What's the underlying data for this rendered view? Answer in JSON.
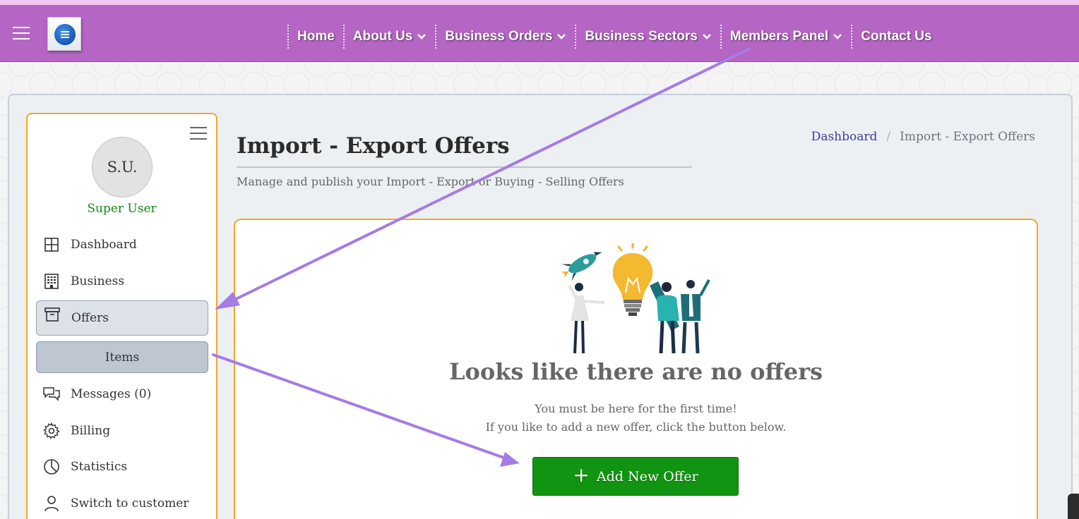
{
  "nav": {
    "items": [
      {
        "label": "Home",
        "dropdown": false
      },
      {
        "label": "About Us",
        "dropdown": true
      },
      {
        "label": "Business Orders",
        "dropdown": true
      },
      {
        "label": "Business Sectors",
        "dropdown": true
      },
      {
        "label": "Members Panel",
        "dropdown": true
      },
      {
        "label": "Contact Us",
        "dropdown": false
      }
    ]
  },
  "sidebar": {
    "avatar_initials": "S.U.",
    "username": "Super User",
    "items": [
      {
        "label": "Dashboard",
        "icon": "grid-icon"
      },
      {
        "label": "Business",
        "icon": "building-icon"
      },
      {
        "label": "Offers",
        "icon": "archive-box-icon",
        "active": true
      },
      {
        "label": "Items",
        "icon": "",
        "sub": true
      },
      {
        "label": "Messages (0)",
        "icon": "chat-icon"
      },
      {
        "label": "Billing",
        "icon": "gear-icon"
      },
      {
        "label": "Statistics",
        "icon": "pie-chart-icon"
      },
      {
        "label": "Switch to customer",
        "icon": "user-icon"
      }
    ]
  },
  "page": {
    "title": "Import - Export Offers",
    "subtitle": "Manage and publish your Import - Export or Buying - Selling Offers",
    "breadcrumb": {
      "home": "Dashboard",
      "current": "Import - Export Offers"
    }
  },
  "empty_state": {
    "title": "Looks like there are no offers",
    "line1": "You must be here for the first time!",
    "line2": "If you like to add a new offer, click the button below.",
    "button_label": "Add New Offer"
  },
  "colors": {
    "navbar": "#b565c3",
    "accent_border": "#f0a826",
    "success_button": "#119411",
    "annotation_arrow": "#a57be6"
  }
}
